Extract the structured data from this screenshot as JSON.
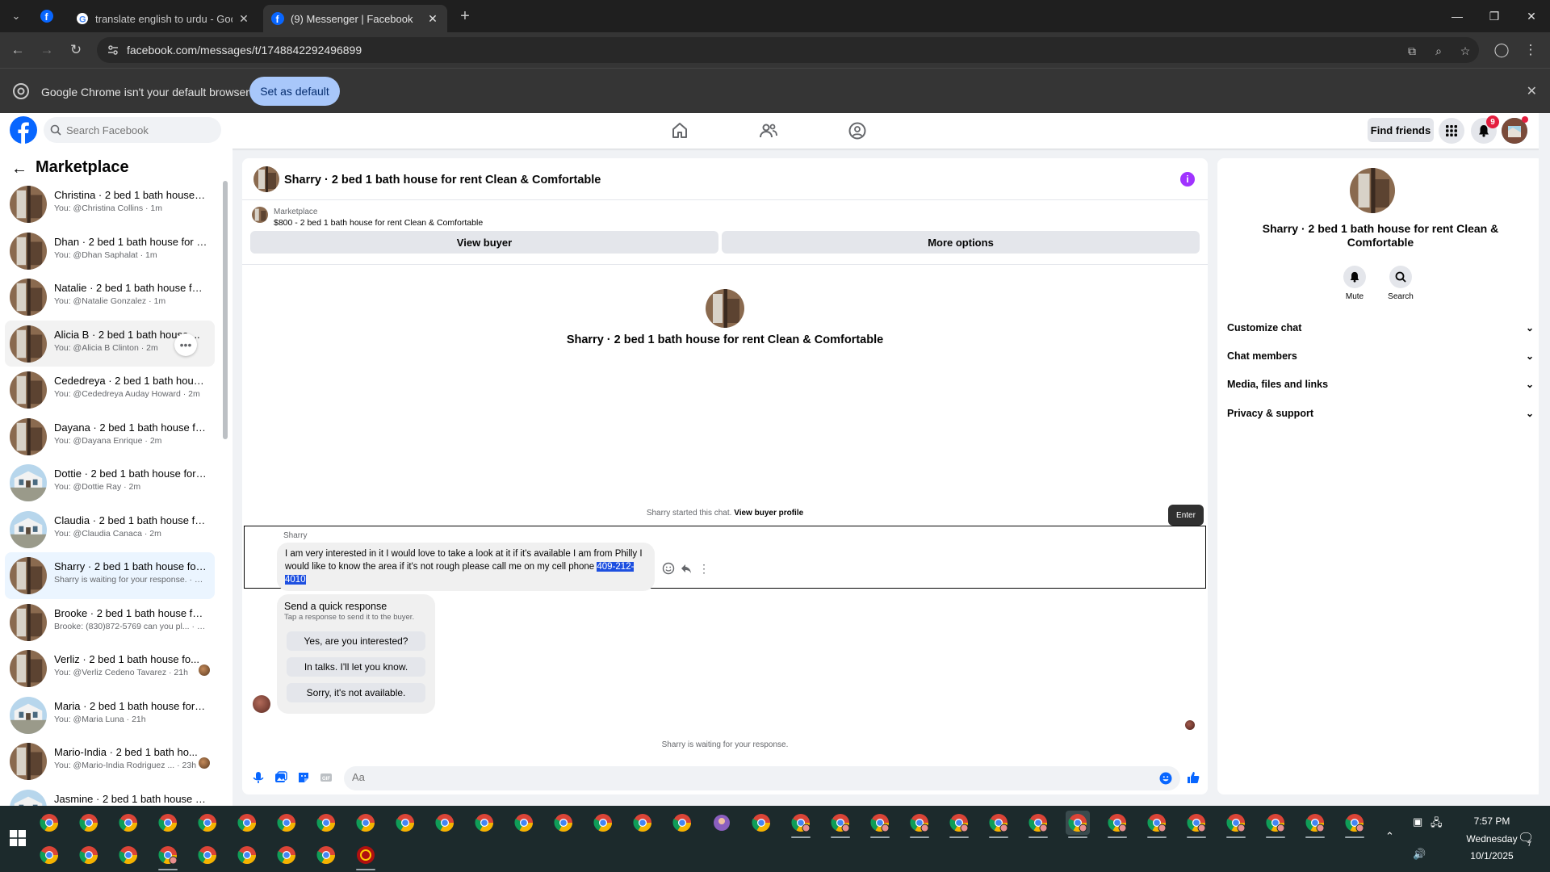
{
  "browser": {
    "tabs": [
      {
        "title": "translate english to urdu - Goo",
        "active": false
      },
      {
        "title": "(9) Messenger | Facebook",
        "active": true
      }
    ],
    "url": "facebook.com/messages/t/1748842292496899",
    "infobar_message": "Google Chrome isn't your default browser",
    "infobar_button": "Set as default"
  },
  "fb_header": {
    "search_placeholder": "Search Facebook",
    "find_friends": "Find friends",
    "notification_count": "9"
  },
  "sidebar": {
    "title": "Marketplace",
    "conversations": [
      {
        "name": "Christina · 2 bed 1 bath house f...",
        "preview": "You: @Christina Collins · 1m",
        "thumb": "brown"
      },
      {
        "name": "Dhan · 2 bed 1 bath house for r...",
        "preview": "You: @Dhan Saphalat · 1m",
        "thumb": "brown"
      },
      {
        "name": "Natalie · 2 bed 1 bath house for ...",
        "preview": "You: @Natalie Gonzalez · 1m",
        "thumb": "brown"
      },
      {
        "name": "Alicia B · 2 bed 1 bath house ...",
        "preview": "You: @Alicia B Clinton · 2m",
        "thumb": "brown",
        "hovered": true
      },
      {
        "name": "Cededreya · 2 bed 1 bath house ...",
        "preview": "You: @Cededreya Auday Howard · 2m",
        "thumb": "brown"
      },
      {
        "name": "Dayana · 2 bed 1 bath house for...",
        "preview": "You: @Dayana Enrique · 2m",
        "thumb": "brown"
      },
      {
        "name": "Dottie · 2 bed 1 bath house for r...",
        "preview": "You: @Dottie Ray · 2m",
        "thumb": "house"
      },
      {
        "name": "Claudia · 2 bed 1 bath house for...",
        "preview": "You: @Claudia Canaca · 2m",
        "thumb": "house"
      },
      {
        "name": "Sharry · 2 bed 1 bath house for ...",
        "preview": "Sharry is waiting for your response. · 10h",
        "thumb": "brown",
        "selected": true
      },
      {
        "name": "Brooke · 2 bed 1 bath house for ...",
        "preview": "Brooke: (830)872-5769 can you pl... · 20h",
        "thumb": "brown"
      },
      {
        "name": "Verliz · 2 bed 1 bath house fo...",
        "preview": "You: @Verliz Cedeno Tavarez · 21h",
        "thumb": "brown",
        "seen": true
      },
      {
        "name": "Maria · 2 bed 1 bath house for r...",
        "preview": "You: @Maria Luna · 21h",
        "thumb": "house"
      },
      {
        "name": "Mario-India · 2 bed 1 bath ho...",
        "preview": "You: @Mario-India Rodriguez ... · 23h",
        "thumb": "brown",
        "seen": true
      },
      {
        "name": "Jasmine · 2 bed 1 bath house fo...",
        "preview": "",
        "thumb": "house"
      }
    ]
  },
  "chat": {
    "title": "Sharry · 2 bed 1 bath house for rent Clean & Comfortable",
    "listing_source": "Marketplace",
    "listing_price": "$800 - 2 bed 1 bath house for rent Clean & Comfortable",
    "view_buyer": "View buyer",
    "more_options": "More options",
    "intro_title": "Sharry · 2 bed 1 bath house for rent Clean & Comfortable",
    "started_text": "Sharry started this chat.",
    "view_buyer_profile": "View buyer profile",
    "enter_tooltip": "Enter",
    "sender_name": "Sharry",
    "message_text": "I am very interested in it I would love to take a look at it if it's available I am from Philly I would like to know the area if it's not rough please call me on my cell phone ",
    "message_phone": "409-212-4010",
    "quick_title": "Send a quick response",
    "quick_subtitle": "Tap a response to send it to the buyer.",
    "quick_responses": [
      "Yes, are you interested?",
      "In talks. I'll let you know.",
      "Sorry, it's not available."
    ],
    "waiting_text": "Sharry is waiting for your response.",
    "composer_placeholder": "Aa"
  },
  "right_panel": {
    "title": "Sharry · 2 bed 1 bath house for rent Clean & Comfortable",
    "mute": "Mute",
    "search": "Search",
    "sections": [
      "Customize chat",
      "Chat members",
      "Media, files and links",
      "Privacy & support"
    ]
  },
  "taskbar": {
    "time": "7:57 PM",
    "day": "Wednesday",
    "date": "10/1/2025",
    "notification_count": "7"
  },
  "colors": {
    "fb_blue": "#0866ff",
    "selected_conv": "#ebf5ff",
    "phone_highlight": "#1d4fe0",
    "info_purple": "#a033ff",
    "chrome_dark": "#1f1f1f"
  }
}
